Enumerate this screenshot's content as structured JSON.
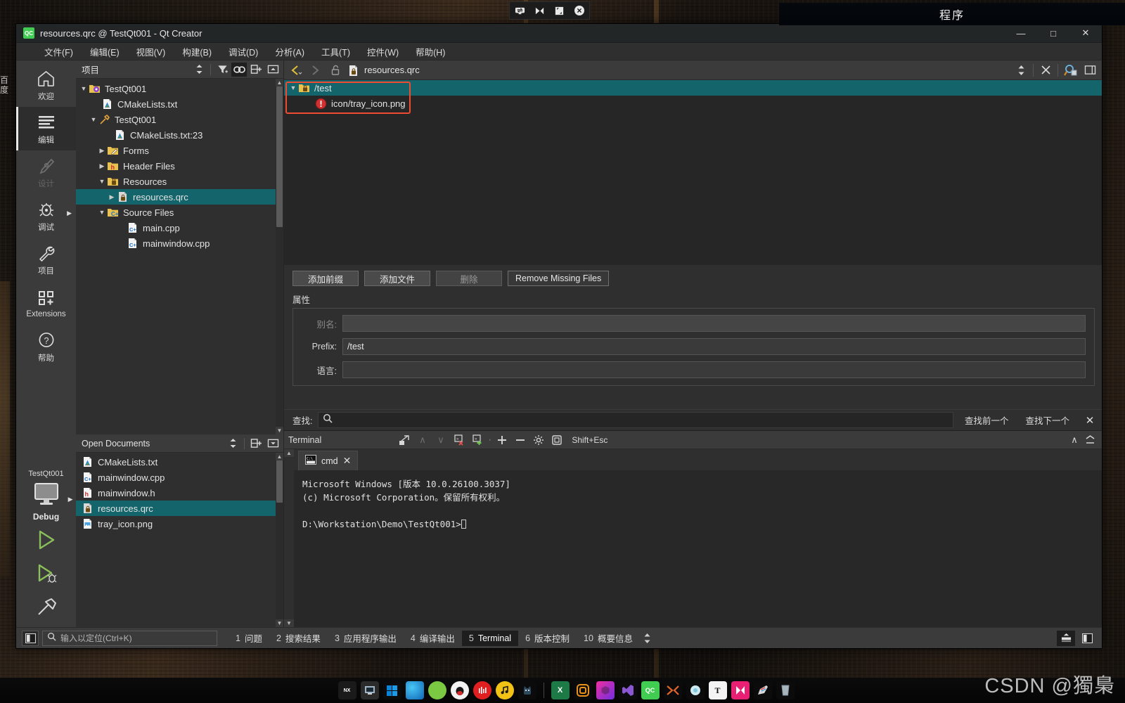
{
  "desktop": {
    "program_bar_title": "程序",
    "side_label": "百度",
    "watermark": "CSDN @獨梟"
  },
  "float_toolbar": {
    "icons": [
      "swap-icon",
      "mirror-icon",
      "resize-icon",
      "close-circle-icon"
    ]
  },
  "window": {
    "title": "resources.qrc @ TestQt001 - Qt Creator",
    "app_icon": "QC",
    "controls": {
      "minimize": "—",
      "maximize": "□",
      "close": "✕"
    }
  },
  "menubar": [
    {
      "label": "文件(F)",
      "mnemonic": "F"
    },
    {
      "label": "编辑(E)",
      "mnemonic": "E"
    },
    {
      "label": "视图(V)",
      "mnemonic": "V"
    },
    {
      "label": "构建(B)",
      "mnemonic": "B"
    },
    {
      "label": "调试(D)",
      "mnemonic": "D"
    },
    {
      "label": "分析(A)",
      "mnemonic": "A"
    },
    {
      "label": "工具(T)",
      "mnemonic": "T"
    },
    {
      "label": "控件(W)",
      "mnemonic": "W"
    },
    {
      "label": "帮助(H)",
      "mnemonic": "H"
    }
  ],
  "modebar": {
    "items": [
      {
        "label": "欢迎",
        "icon": "home-icon",
        "state": "normal"
      },
      {
        "label": "编辑",
        "icon": "edit-lines-icon",
        "state": "active"
      },
      {
        "label": "设计",
        "icon": "design-pen-icon",
        "state": "disabled"
      },
      {
        "label": "调试",
        "icon": "bug-icon",
        "state": "normal",
        "arrow": true
      },
      {
        "label": "项目",
        "icon": "wrench-icon",
        "state": "normal"
      },
      {
        "label": "Extensions",
        "icon": "extensions-grid-icon",
        "state": "normal"
      },
      {
        "label": "帮助",
        "icon": "question-circle-icon",
        "state": "normal"
      }
    ],
    "kit": {
      "project_name": "TestQt001",
      "build_config": "Debug",
      "target_icon": "desktop-monitor-icon",
      "run_icon": "run-play-icon",
      "debug_icon": "debug-play-icon",
      "build_icon": "hammer-icon"
    }
  },
  "projects_panel": {
    "title": "项目",
    "tools": [
      "sync-filter-icon",
      "filter-icon",
      "link-icon",
      "split-add-icon",
      "collapse-icon"
    ],
    "tree": [
      {
        "depth": 0,
        "label": "TestQt001",
        "icon": "project-folder-icon",
        "twist": "open"
      },
      {
        "depth": 1,
        "label": "CMakeLists.txt",
        "icon": "cmake-icon",
        "twist": "none"
      },
      {
        "depth": 1,
        "label": "TestQt001",
        "icon": "hammer-icon",
        "twist": "open"
      },
      {
        "depth": 2,
        "label": "CMakeLists.txt:23",
        "icon": "cmake-icon",
        "twist": "none"
      },
      {
        "depth": 2,
        "label": "Forms",
        "icon": "forms-folder-icon",
        "twist": "closed"
      },
      {
        "depth": 2,
        "label": "Header Files",
        "icon": "header-folder-icon",
        "twist": "closed"
      },
      {
        "depth": 2,
        "label": "Resources",
        "icon": "resource-folder-icon",
        "twist": "open"
      },
      {
        "depth": 3,
        "label": "resources.qrc",
        "icon": "qrc-file-icon",
        "twist": "closed",
        "selected": true
      },
      {
        "depth": 2,
        "label": "Source Files",
        "icon": "source-folder-icon",
        "twist": "open"
      },
      {
        "depth": 3,
        "label": "main.cpp",
        "icon": "cpp-file-icon",
        "twist": "none"
      },
      {
        "depth": 3,
        "label": "mainwindow.cpp",
        "icon": "cpp-file-icon",
        "twist": "none"
      }
    ]
  },
  "open_documents": {
    "title": "Open Documents",
    "tools": [
      "sync-icon",
      "split-add-icon",
      "dropdown-icon"
    ],
    "items": [
      {
        "label": "CMakeLists.txt",
        "icon": "cmake-icon"
      },
      {
        "label": "mainwindow.cpp",
        "icon": "cpp-file-icon"
      },
      {
        "label": "mainwindow.h",
        "icon": "header-file-icon"
      },
      {
        "label": "resources.qrc",
        "icon": "qrc-file-icon",
        "selected": true
      },
      {
        "label": "tray_icon.png",
        "icon": "image-file-icon"
      }
    ]
  },
  "editor_toolbar": {
    "back": "back-arrow-icon",
    "forward": "forward-arrow-icon",
    "lock": "unlock-icon",
    "file_icon": "qrc-file-icon",
    "file_name": "resources.qrc",
    "split_selector": "updown-arrows-icon",
    "close": "close-icon",
    "extra": "qrc-editor-icon"
  },
  "resource_tree": [
    {
      "depth": 0,
      "label": "/test",
      "icon": "prefix-folder-icon",
      "twist": "open",
      "selected": true
    },
    {
      "depth": 1,
      "label": "icon/tray_icon.png",
      "icon": "error-icon",
      "twist": "none"
    }
  ],
  "resource_buttons": [
    {
      "label": "添加前缀",
      "state": "normal"
    },
    {
      "label": "添加文件",
      "state": "normal"
    },
    {
      "label": "删除",
      "state": "disabled"
    },
    {
      "label": "Remove Missing Files",
      "state": "plain"
    }
  ],
  "properties": {
    "section_label": "属性",
    "rows": [
      {
        "label": "别名:",
        "value": "",
        "disabled": true
      },
      {
        "label": "Prefix:",
        "value": "/test",
        "disabled": false
      },
      {
        "label": "语言:",
        "value": "",
        "disabled": false
      }
    ]
  },
  "find_bar": {
    "label": "查找:",
    "icon": "search-icon",
    "value": "",
    "prev_label": "查找前一个",
    "next_label": "查找下一个",
    "close": "✕"
  },
  "output_pane": {
    "title": "Terminal",
    "tools": [
      "new-terminal-icon",
      "up-icon",
      "down-icon",
      "stop-red-icon",
      "add-green-icon",
      "plus-icon",
      "minus-icon",
      "gear-icon",
      "maximize-pane-icon"
    ],
    "shortcut": "Shift+Esc",
    "collapse": "chevron-up-icon",
    "maximize": "chevron-bar-icon",
    "tab": {
      "label": "cmd",
      "icon": "console-icon",
      "close": "✕"
    },
    "terminal_lines": [
      "Microsoft Windows [版本 10.0.26100.3037]",
      "(c) Microsoft Corporation。保留所有权利。",
      "",
      "D:\\Workstation\\Demo\\TestQt001>"
    ]
  },
  "status_bar": {
    "sidebar_toggle": "sidebar-icon",
    "locator": {
      "icon": "search-icon",
      "placeholder": "输入以定位(Ctrl+K)",
      "value": ""
    },
    "panes": [
      {
        "num": "1",
        "label": "问题",
        "active": false
      },
      {
        "num": "2",
        "label": "搜索结果",
        "active": false
      },
      {
        "num": "3",
        "label": "应用程序输出",
        "active": false
      },
      {
        "num": "4",
        "label": "编译输出",
        "active": false
      },
      {
        "num": "5",
        "label": "Terminal",
        "active": true
      },
      {
        "num": "6",
        "label": "版本控制",
        "active": false
      },
      {
        "num": "10",
        "label": "概要信息",
        "active": false
      }
    ],
    "right_buttons": [
      "output-toggle-icon",
      "sidebar-right-icon"
    ]
  },
  "taskbar": {
    "icons": [
      "nexus",
      "computer",
      "windows",
      "edge",
      "wechat",
      "qq",
      "music-red",
      "music-yellow",
      "cat",
      "excel",
      "obs",
      "unity",
      "visual-studio",
      "qt-creator",
      "xmind",
      "photo",
      "typora",
      "flag-pink",
      "paint",
      "glass"
    ]
  }
}
